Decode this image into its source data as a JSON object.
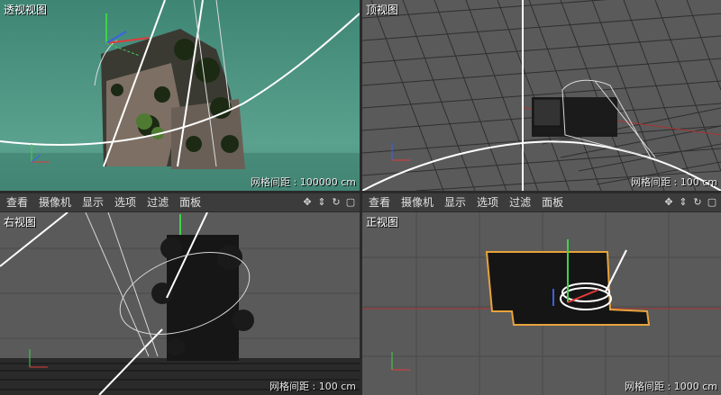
{
  "viewports": {
    "perspective": {
      "title": "透视视图",
      "grid_label": "网格间距 : 100000 cm"
    },
    "top": {
      "title": "顶视图",
      "grid_label": "网格间距 : 100 cm"
    },
    "right": {
      "title": "右视图",
      "grid_label": "网格间距 : 100 cm"
    },
    "front": {
      "title": "正视图",
      "grid_label": "网格间距 : 1000 cm"
    }
  },
  "menu": {
    "items": [
      "查看",
      "摄像机",
      "显示",
      "选项",
      "过滤",
      "面板"
    ]
  },
  "viewport_controls": [
    {
      "name": "move-view-icon",
      "glyph": "✥"
    },
    {
      "name": "zoom-view-icon",
      "glyph": "⇕"
    },
    {
      "name": "rotate-view-icon",
      "glyph": "↻"
    },
    {
      "name": "maximize-view-icon",
      "glyph": "▢"
    }
  ],
  "colors": {
    "active_border": "#e8a33a",
    "perspective_bg": "#4f9382",
    "ortho_bg": "#5a5a5a",
    "axis_x": "#e23b3b",
    "axis_y": "#3fd24a",
    "axis_z": "#3b62e2"
  }
}
